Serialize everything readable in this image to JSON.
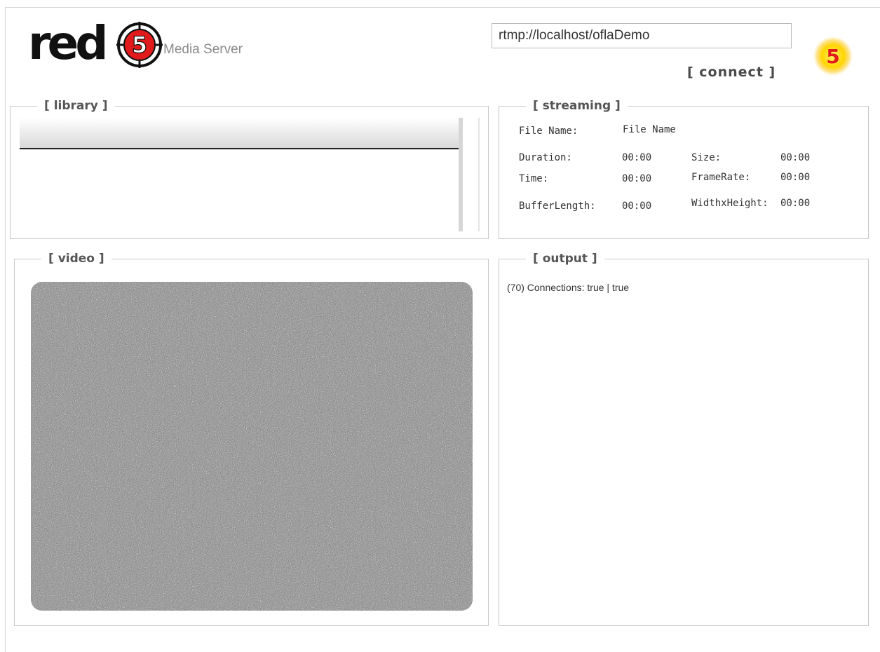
{
  "header": {
    "logo_text": "red",
    "logo_tagline": "Media Server",
    "url_value": "rtmp://localhost/oflaDemo",
    "connect_label": "[ connect ]",
    "badge_number": "5"
  },
  "library": {
    "title": "[ library ]"
  },
  "streaming": {
    "title": "[ streaming ]",
    "file_name_label": "File Name:",
    "file_name_value": "File Name",
    "duration_label": "Duration:",
    "duration_value": "00:00",
    "size_label": "Size:",
    "size_value": "00:00",
    "time_label": "Time:",
    "time_value": "00:00",
    "framerate_label": "FrameRate:",
    "framerate_value": "00:00",
    "bufferlength_label": "BufferLength:",
    "bufferlength_value": "00:00",
    "widthheight_label": "WidthxHeight:",
    "widthheight_value": "00:00"
  },
  "video": {
    "title": "[ video ]"
  },
  "output": {
    "title": "[ output ]",
    "log": "(70) Connections: true | true"
  },
  "colors": {
    "accent_red": "#e11b1b",
    "badge_yellow": "#ffd400",
    "border": "#c8c8c8"
  }
}
